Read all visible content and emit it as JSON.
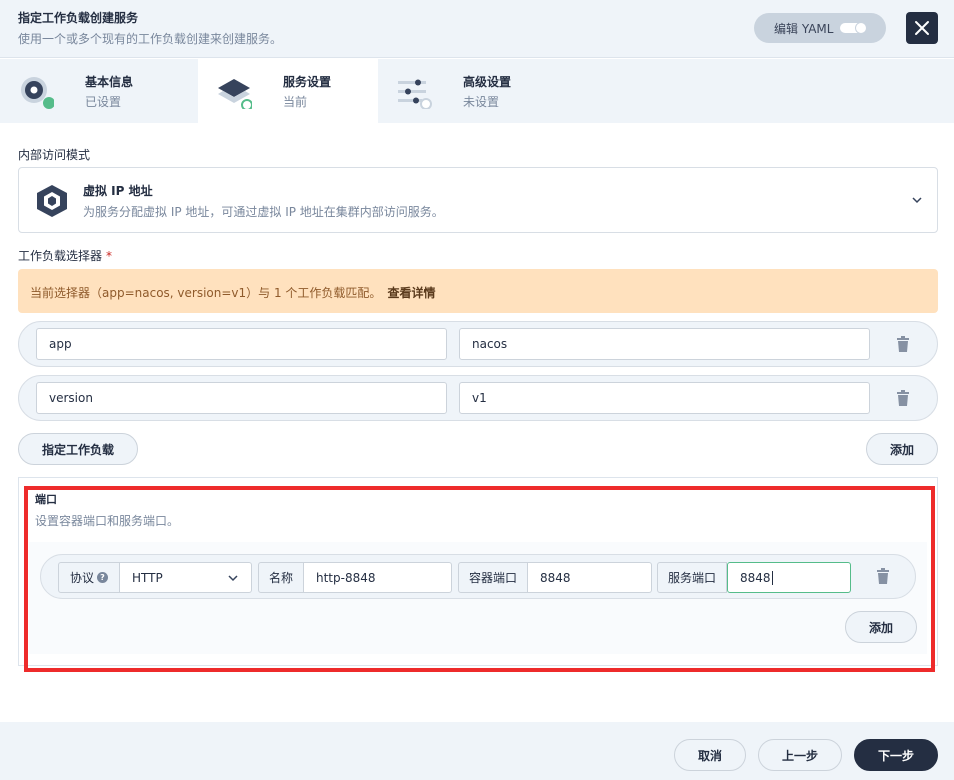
{
  "header": {
    "title": "指定工作负载创建服务",
    "subtitle": "使用一个或多个现有的工作负载创建来创建服务。",
    "yaml_label": "编辑 YAML"
  },
  "steps": [
    {
      "name": "基本信息",
      "state": "已设置",
      "icon": "info-step-icon"
    },
    {
      "name": "服务设置",
      "state": "当前",
      "icon": "layers-step-icon"
    },
    {
      "name": "高级设置",
      "state": "未设置",
      "icon": "sliders-step-icon"
    }
  ],
  "access_mode": {
    "label": "内部访问模式",
    "title": "虚拟 IP 地址",
    "description": "为服务分配虚拟 IP 地址，可通过虚拟 IP 地址在集群内部访问服务。"
  },
  "selector": {
    "label": "工作负载选择器",
    "required_mark": "*",
    "notice": "当前选择器（app=nacos, version=v1）与 1 个工作负载匹配。",
    "notice_link": "查看详情",
    "rows": [
      {
        "key": "app",
        "value": "nacos"
      },
      {
        "key": "version",
        "value": "v1"
      }
    ],
    "specify_button": "指定工作负载",
    "add_button": "添加"
  },
  "ports": {
    "title": "端口",
    "description": "设置容器端口和服务端口。",
    "row": {
      "protocol_label": "协议",
      "protocol_help": "?",
      "protocol_value": "HTTP",
      "name_label": "名称",
      "name_value": "http-8848",
      "container_port_label": "容器端口",
      "container_port_value": "8848",
      "service_port_label": "服务端口",
      "service_port_value": "8848"
    },
    "add_button": "添加"
  },
  "footer": {
    "cancel": "取消",
    "prev": "上一步",
    "next": "下一步"
  },
  "colors": {
    "primary_dark": "#242e42",
    "success": "#55bc8a",
    "warning_bg": "#ffe1be",
    "highlight_border": "#ee2b2b"
  }
}
